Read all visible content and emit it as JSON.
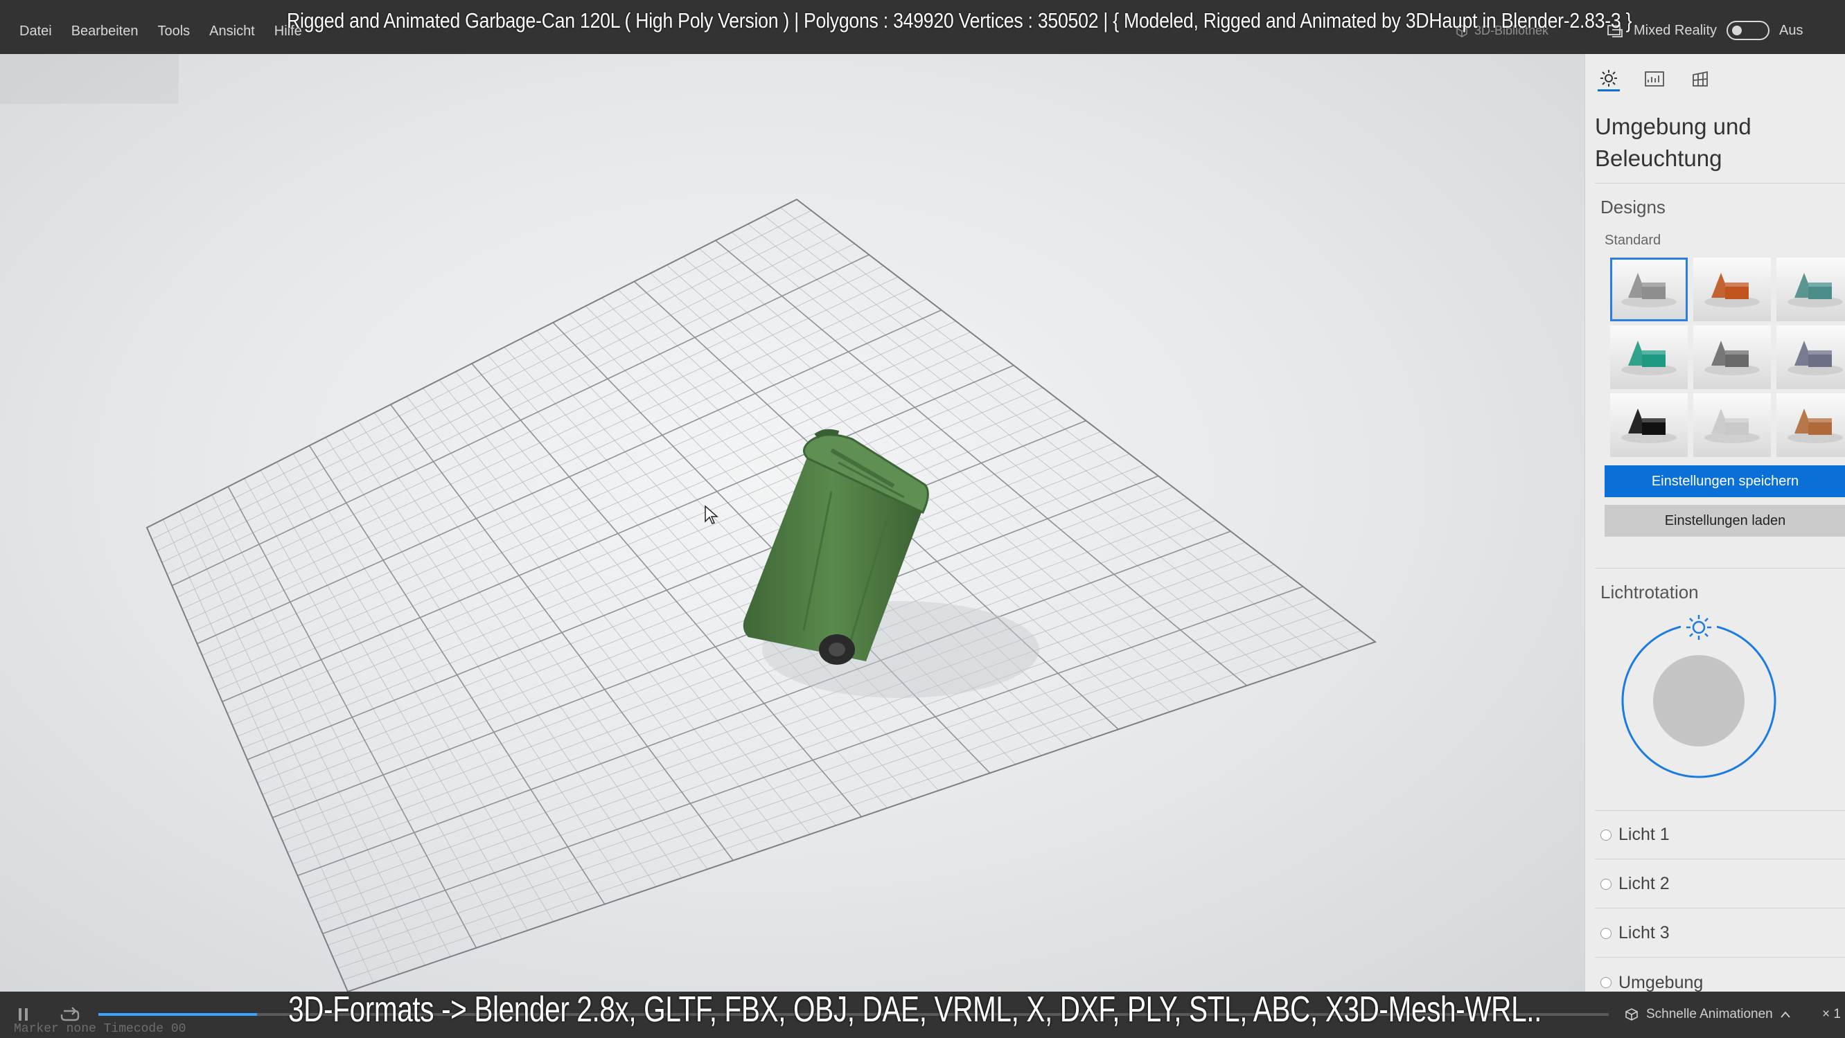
{
  "window": {
    "menu": [
      "Datei",
      "Bearbeiten",
      "Tools",
      "Ansicht",
      "Hilfe"
    ],
    "title_overlay": "Rigged and Animated Garbage-Can 120L ( High Poly Version )  |   Polygons : 349920  Vertices : 350502   |   { Modeled, Rigged and Animated by 3DHaupt in Blender-2.83-3 }",
    "library_label": "3D-Bibliothek",
    "mixed_reality_label": "Mixed Reality",
    "mixed_reality_state": "Aus"
  },
  "panel": {
    "tabs": [
      {
        "icon": "sun-icon",
        "active": true
      },
      {
        "icon": "image-stats-icon",
        "active": false
      },
      {
        "icon": "grid-icon",
        "active": false
      }
    ],
    "title": "Umgebung und Beleuchtung",
    "designs_heading": "Designs",
    "standard_label": "Standard",
    "design_thumbs": [
      {
        "color": "#8e8e8e",
        "selected": true
      },
      {
        "color": "#c0541e",
        "selected": false
      },
      {
        "color": "#4a8c88",
        "selected": false
      },
      {
        "color": "#1f9a82",
        "selected": false
      },
      {
        "color": "#6a6a6a",
        "selected": false
      },
      {
        "color": "#6d6f86",
        "selected": false
      },
      {
        "color": "#111111",
        "selected": false
      },
      {
        "color": "#c9c9c9",
        "selected": false
      },
      {
        "color": "#b06a3a",
        "selected": false
      }
    ],
    "save_button": "Einstellungen speichern",
    "load_button": "Einstellungen laden",
    "light_rotation_heading": "Lichtrotation",
    "lights": [
      "Licht 1",
      "Licht 2",
      "Licht 3",
      "Umgebung"
    ]
  },
  "bottom": {
    "formats_overlay": "3D-Formats -> Blender 2.8x, GLTF, FBX, OBJ, DAE, VRML, X, DXF, PLY, STL, ABC, X3D-Mesh-WRL..",
    "animations_label": "Schnelle Animationen",
    "speed_label": "× 1",
    "timecode": "Marker  none   Timecode 00",
    "progress": 0.105
  },
  "colors": {
    "accent": "#0a6fd6",
    "bin_green": "#4f7a44",
    "bar_bg": "#333333"
  }
}
